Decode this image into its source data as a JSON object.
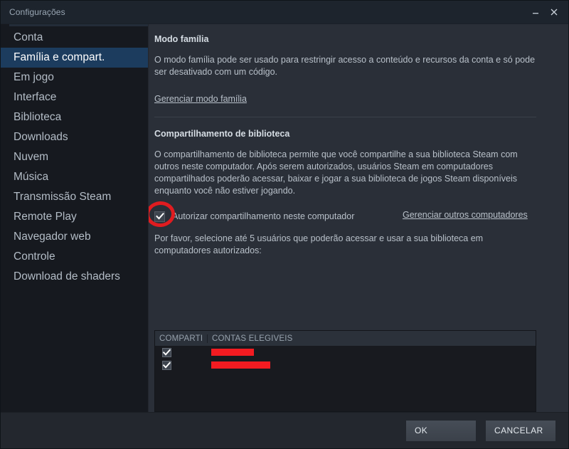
{
  "window": {
    "title": "Configurações",
    "controls": {
      "minimize": "minimize-icon",
      "close": "close-icon"
    }
  },
  "sidebar": {
    "items": [
      {
        "label": "Conta",
        "selected": false
      },
      {
        "label": "Família e compart.",
        "selected": true
      },
      {
        "label": "Em jogo",
        "selected": false
      },
      {
        "label": "Interface",
        "selected": false
      },
      {
        "label": "Biblioteca",
        "selected": false
      },
      {
        "label": "Downloads",
        "selected": false
      },
      {
        "label": "Nuvem",
        "selected": false
      },
      {
        "label": "Música",
        "selected": false
      },
      {
        "label": "Transmissão Steam",
        "selected": false
      },
      {
        "label": "Remote Play",
        "selected": false
      },
      {
        "label": "Navegador web",
        "selected": false
      },
      {
        "label": "Controle",
        "selected": false
      },
      {
        "label": "Download de shaders",
        "selected": false
      }
    ]
  },
  "main": {
    "family_mode": {
      "title": "Modo família",
      "description": "O modo família pode ser usado para restringir acesso a conteúdo e recursos da conta e só pode ser desativado com um código.",
      "link": "Gerenciar modo família"
    },
    "library_sharing": {
      "title": "Compartilhamento de biblioteca",
      "description": "O compartilhamento de biblioteca permite que você compartilhe a sua biblioteca Steam com outros neste computador. Após serem autorizados, usuários Steam em computadores compartilhados poderão acessar, baixar e jogar a sua biblioteca de jogos Steam disponíveis enquanto você não estiver jogando.",
      "authorize_checkbox": {
        "label": "Autorizar compartilhamento neste computador",
        "checked": true
      },
      "manage_link": "Gerenciar outros computadores",
      "select_users_note": "Por favor, selecione até 5 usuários que poderão acessar e usar a sua biblioteca em computadores autorizados:"
    },
    "accounts_table": {
      "columns": [
        "COMPARTI",
        "CONTAS ELEGÍVEIS"
      ],
      "rows": [
        {
          "shared": true,
          "account": "",
          "redacted": true,
          "redacted_width": 40
        },
        {
          "shared": true,
          "account": "",
          "redacted": true,
          "redacted_width": 82
        }
      ]
    }
  },
  "footer": {
    "ok_label": "OK",
    "cancel_label": "CANCELAR"
  },
  "annotation": {
    "type": "red-circle-highlight",
    "target": "authorize-sharing-checkbox",
    "color": "#e01c20"
  }
}
